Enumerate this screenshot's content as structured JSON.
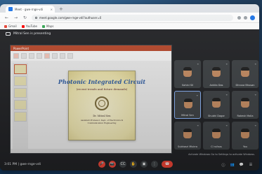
{
  "browser": {
    "tab_title": "Meet - gwe-rnge-vdi",
    "tab_close": "×",
    "new_tab": "+",
    "url": "meet.google.com/gwe-rnge-vdi?authuser=0",
    "bookmarks": [
      {
        "label": "Gmail",
        "color": "#ea4335"
      },
      {
        "label": "YouTube",
        "color": "#ff0000"
      },
      {
        "label": "Maps",
        "color": "#34a853"
      }
    ]
  },
  "meet": {
    "presenting_text": "Mitral Sen is presenting",
    "slide": {
      "title": "Photonic Integrated Circuit",
      "subtitle": "(recent trends and future demands)",
      "presenter": "Dr. Mitral Sen",
      "dept": "Assistant Professor, Dept. of Electronics & Communication Engineering"
    },
    "participants": [
      {
        "name": "Sohini Sil",
        "mic": "⌁"
      },
      {
        "name": "Ankita Das",
        "mic": "⌁"
      },
      {
        "name": "Dhruva Bhusan",
        "mic": "⌁"
      },
      {
        "name": "Mitral Sen",
        "mic": "⌁"
      },
      {
        "name": "Shubhi Dagar",
        "mic": "⌁"
      },
      {
        "name": "Rakesh Malla",
        "mic": "⌁"
      },
      {
        "name": "Subhasri Mishra",
        "mic": "⌁"
      },
      {
        "name": "CI rufaus",
        "mic": "⌁"
      },
      {
        "name": "You",
        "mic": "⌁"
      }
    ],
    "meeting_info": "3:01 PM | gwe-rnge-vdi",
    "activate_windows": "Activate Windows\nGo to Settings to activate Windows.",
    "controls": {
      "mic": "🎤",
      "cam": "📷",
      "cc": "CC",
      "hand": "✋",
      "present": "▣",
      "more": "⋮",
      "end": "☎",
      "info": "ⓘ",
      "people": "👥",
      "chat": "💬",
      "activities": "☰"
    }
  }
}
